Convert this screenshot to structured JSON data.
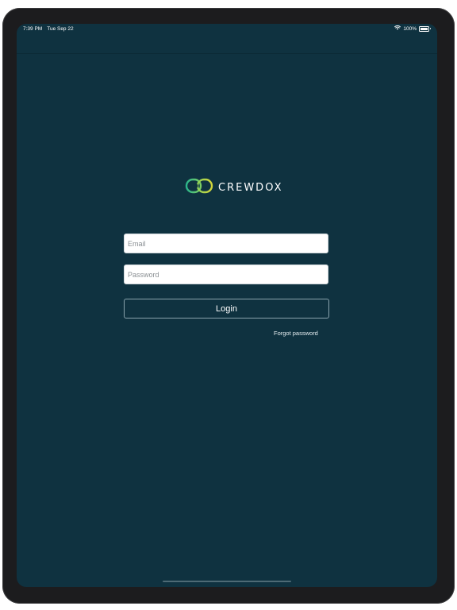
{
  "status_bar": {
    "time": "7:39 PM",
    "date": "Tue Sep 22",
    "battery_percent": "100%",
    "wifi_icon": "wifi-icon",
    "battery_icon": "battery-icon"
  },
  "brand": {
    "name": "CREWDOX",
    "logo_icon": "crewdox-chain-logo-icon",
    "colors": {
      "background": "#0f3240",
      "logo_green": "#2bb58c",
      "logo_yellow": "#d3d63a"
    }
  },
  "login_form": {
    "email_placeholder": "Email",
    "email_value": "",
    "password_placeholder": "Password",
    "password_value": "",
    "login_label": "Login",
    "forgot_password_label": "Forgot password"
  }
}
